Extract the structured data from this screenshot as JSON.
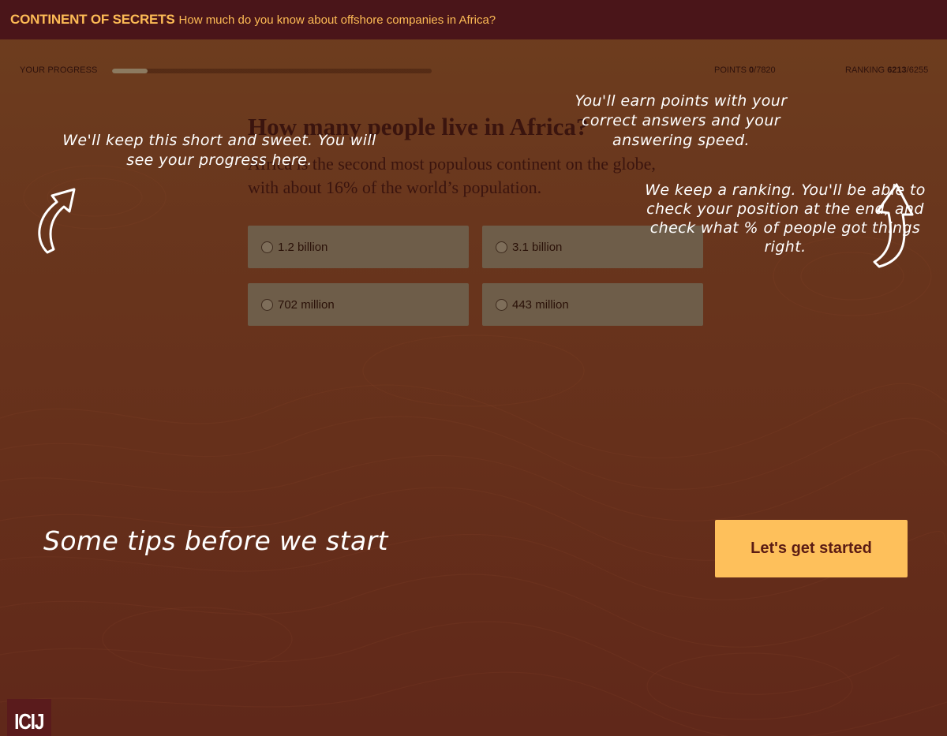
{
  "header": {
    "title": "CONTINENT OF SECRETS",
    "subtitle": "How much do you know about offshore companies in Africa?"
  },
  "progress": {
    "label": "YOUR PROGRESS",
    "fraction": 0.11,
    "points_label": "POINTS ",
    "points_value": "0",
    "points_total": "/7820",
    "ranking_label": "RANKING ",
    "ranking_value": "6213",
    "ranking_total": "/6255"
  },
  "question": {
    "title": "How many people live in Africa?",
    "description": "Africa is the second most populous continent on the globe, with about 16% of the world’s population."
  },
  "answers": [
    "1.2 billion",
    "3.1 billion",
    "702 million",
    "443 million"
  ],
  "tips": {
    "progress_note": "We'll keep this short and sweet. You will see your progress here.",
    "points_note": "You'll earn points with your correct answers and your answering speed.",
    "ranking_note": "We keep a ranking. You'll be able to check your position at the end, and check what % of people got things right.",
    "intro": "Some tips before we start"
  },
  "start_button": "Let's get started",
  "logo": "ICIJ",
  "colors": {
    "header_bg": "#4a1519",
    "accent": "#fec05b",
    "answer_bg": "#6e5d49",
    "background": "#6a361d"
  },
  "icons": {
    "progress_arrow": "curved-arrow-up-right-icon",
    "ranking_arrow": "curved-arrow-up-icon"
  }
}
